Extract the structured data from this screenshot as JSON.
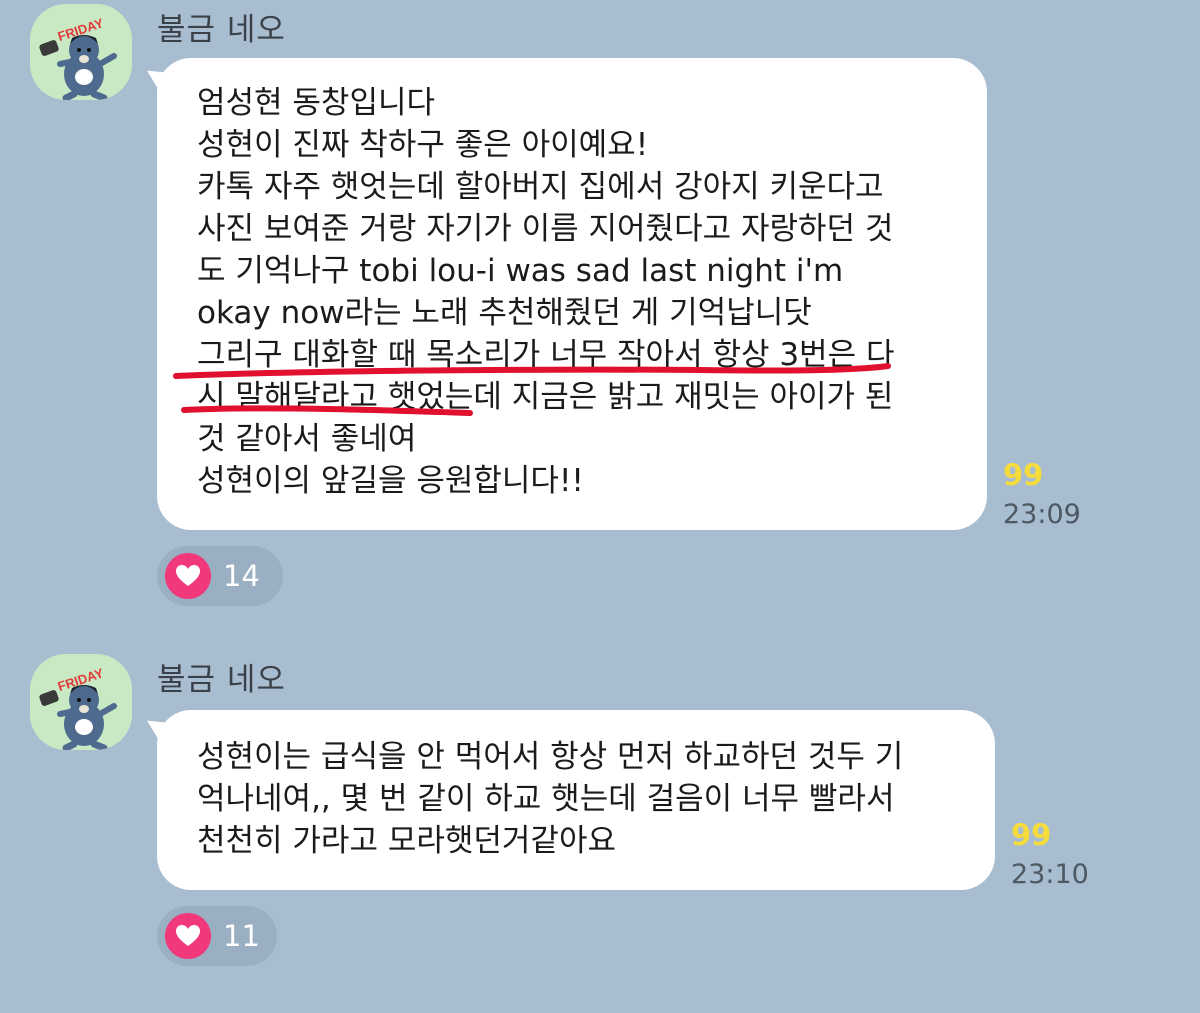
{
  "messages": [
    {
      "sender": "불금 네오",
      "lines": [
        "엄성현 동창입니다",
        "성현이 진짜 착하구 좋은 아이예요!",
        "카톡 자주 햇엇는데 할아버지 집에서 강아지 키운다고",
        "사진 보여준 거랑 자기가 이름 지어줬다고 자랑하던 것",
        "도 기억나구 tobi lou-i was sad last night i'm",
        "okay now라는 노래 추천해줬던 게 기억납니닷",
        "그리구 대화할 때 목소리가 너무 작아서 항상 3번은 다",
        "시 말해달라고 햇었는데 지금은 밝고 재밋는 아이가 된",
        "것 같아서 좋네여",
        "성현이의 앞길을 응원합니다!!"
      ],
      "unread": "99",
      "time": "23:09",
      "reaction": {
        "icon": "heart-icon",
        "count": "14"
      }
    },
    {
      "sender": "불금 네오",
      "lines": [
        "성현이는 급식을 안 먹어서 항상 먼저 하교하던 것두 기",
        "억나네여,, 몇 번 같이 하교 햇는데 걸음이 너무 빨라서",
        "천천히 가라고 모라햇던거같아요"
      ],
      "unread": "99",
      "time": "23:10",
      "reaction": {
        "icon": "heart-icon",
        "count": "11"
      }
    }
  ],
  "colors": {
    "background": "#a9bdd0",
    "bubble": "#ffffff",
    "unread": "#f6dc3b",
    "heart": "#f1387a",
    "underline": "#e0102e"
  }
}
